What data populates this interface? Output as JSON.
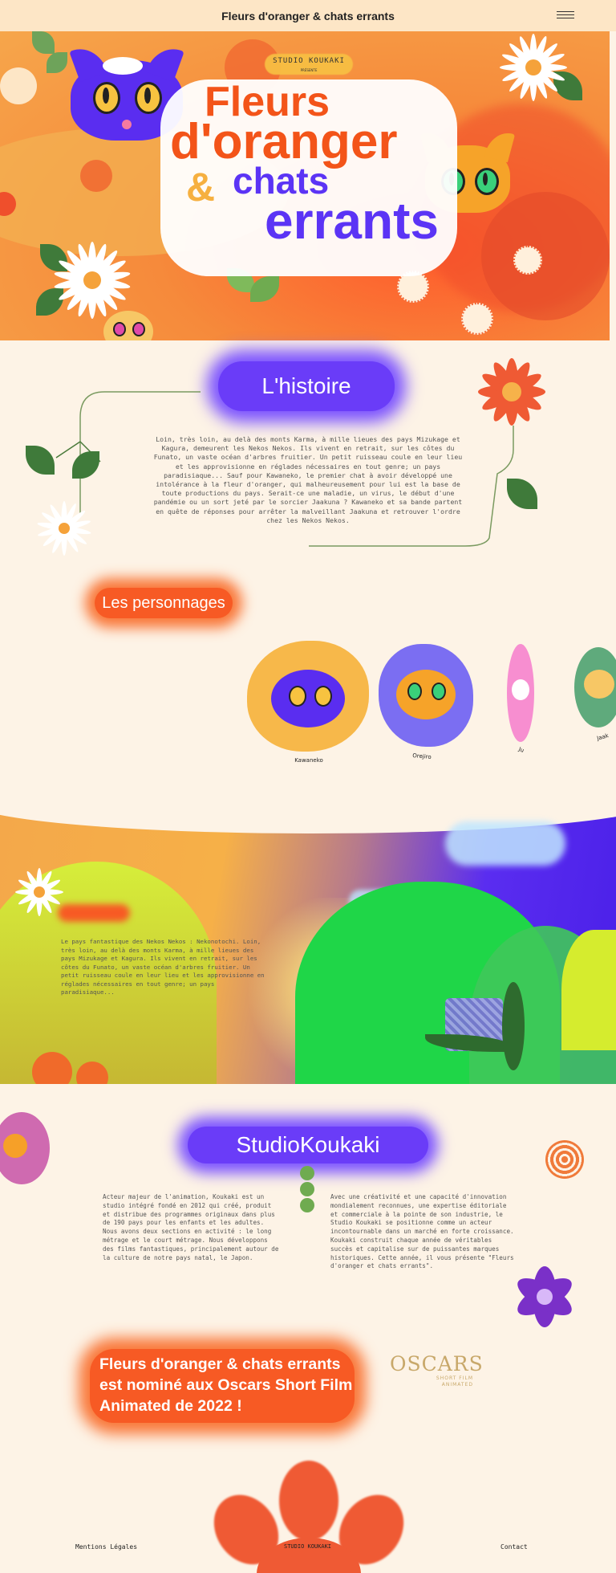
{
  "header": {
    "title": "Fleurs d'oranger & chats errants",
    "menu_icon": "hamburger-menu-icon"
  },
  "hero": {
    "badge": "STUDIO KOUKAKI",
    "badge_sub": "PRÉSENTE",
    "title_line1": "Fleurs",
    "title_line2": "d'oranger",
    "title_amp": "&",
    "title_line3": "chats",
    "title_line4": "errants"
  },
  "histoire": {
    "heading": "L'histoire",
    "text": "Loin, très loin, au delà des monts Karma, à mille lieues des pays Mizukage et Kagura, demeurent les Nekos Nekos. Ils vivent en retrait, sur les côtes du Funato, un vaste océan d'arbres fruitier. Un petit ruisseau coule en leur lieu et les approvisionne en réglades nécessaires en tout genre; un pays paradisiaque... Sauf pour Kawaneko, le premier chat à avoir développé une intolérance à la fleur d'oranger, qui malheureusement pour lui est la base de toute productions du pays. Serait-ce une maladie, un virus, le début d'une pandémie ou un sort jeté par le sorcier Jaakuna ? Kawaneko et sa bande partent en quête de réponses pour arrêter la malveillant Jaakuna et retrouver l'ordre chez les Nekos Nekos."
  },
  "personnages": {
    "heading": "Les personnages",
    "characters": [
      {
        "name": "Kawaneko"
      },
      {
        "name": "Orejiro"
      },
      {
        "name": "Ju"
      },
      {
        "name": "Jaak"
      }
    ]
  },
  "place": {
    "text": "Le pays fantastique des Nekos Nekos : Nekonotochi. Loin, très loin, au delà des monts Karma, à mille lieues des pays Mizukage et Kagura. Ils vivent en retrait, sur les côtes du Funato, un vaste océan d'arbres fruitier. Un petit ruisseau coule en leur lieu et les approvisionne en réglades nécessaires en tout genre; un pays paradisiaque..."
  },
  "studio": {
    "heading": "StudioKoukaki",
    "col1": "Acteur majeur de l'animation, Koukaki est un studio intégré fondé en 2012 qui créé, produit et distribue des programmes originaux dans plus de 190 pays pour les enfants et les adultes. Nous avons deux sections en activité : le long métrage et le court métrage. Nous développons des films fantastiques, principalement autour de la culture de notre pays natal, le Japon.",
    "col2": "Avec une créativité et une capacité d'innovation mondialement reconnues, une expertise éditoriale et commerciale à la pointe de son industrie, le Studio Koukaki se positionne comme un acteur incontournable dans un marché en forte croissance. Koukaki construit chaque année de véritables succès et capitalise sur de puissantes marques historiques. Cette année, il vous présente \"Fleurs d'oranger et chats errants\"."
  },
  "oscars": {
    "text": "Fleurs d'oranger & chats errants est nominé aux Oscars Short Film Animated de 2022 !",
    "logo_main": "OSCARS",
    "logo_sub1": "SHORT FILM",
    "logo_sub2": "ANIMATED"
  },
  "footer": {
    "legal": "Mentions Légales",
    "studio": "STUDIO KOUKAKI",
    "contact": "Contact"
  },
  "colors": {
    "orange": "#f75a24",
    "purple": "#5b34f5",
    "cream": "#fdf3e6",
    "yellow": "#f6b24a"
  }
}
